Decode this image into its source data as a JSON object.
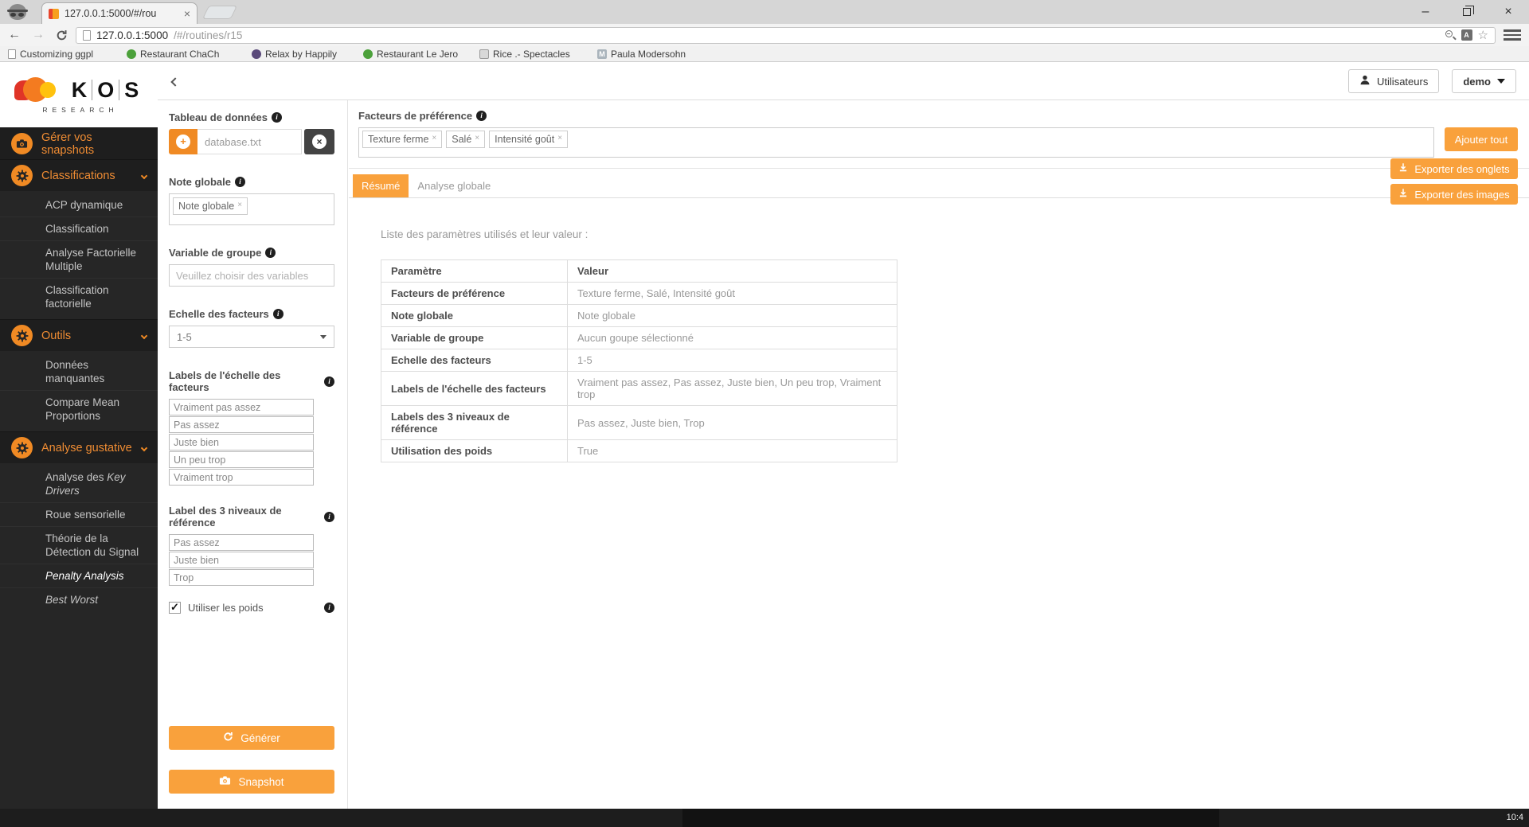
{
  "icons": {
    "plus": "+",
    "close": "×",
    "minimize": "–",
    "star": "☆",
    "arrow_left": "←",
    "arrow_right": "→",
    "translate_letter": "A",
    "paula_initial": "M"
  },
  "browser": {
    "tab": {
      "title": "127.0.0.1:5000/#/rou"
    },
    "url": {
      "host": "127.0.0.1:5000",
      "path": "/#/routines/r15"
    },
    "bookmarks": [
      {
        "label": "Customizing ggpl"
      },
      {
        "label": "Restaurant ChaCh"
      },
      {
        "label": "Relax by Happily"
      },
      {
        "label": "Restaurant Le Jero"
      },
      {
        "label": "Rice .- Spectacles"
      },
      {
        "label": "Paula Modersohn"
      }
    ]
  },
  "header": {
    "users": "Utilisateurs",
    "account": "demo"
  },
  "sidebar": {
    "logo_letters": [
      "K",
      "O",
      "S"
    ],
    "logo_sub": "RESEARCH",
    "items": [
      {
        "label": "Gérer vos snapshots"
      },
      {
        "label": "Classifications"
      },
      {
        "label": "Outils"
      },
      {
        "label": "Analyse gustative"
      }
    ],
    "classifications_children": [
      "ACP dynamique",
      "Classification",
      "Analyse Factorielle Multiple",
      "Classification factorielle"
    ],
    "outils_children": [
      "Données manquantes",
      "Compare Mean Proportions"
    ],
    "gustative_children": [
      {
        "prefix": "Analyse des ",
        "italic": "Key Drivers"
      },
      {
        "label": "Roue sensorielle"
      },
      {
        "label": "Théorie de la Détection du Signal"
      },
      {
        "label": "Penalty Analysis"
      },
      {
        "label": "Best Worst"
      }
    ]
  },
  "form": {
    "dataset_label": "Tableau de données",
    "dataset_value": "database.txt",
    "note_label": "Note globale",
    "note_tag": "Note globale",
    "group_label": "Variable de groupe",
    "group_placeholder": "Veuillez choisir des variables",
    "scale_label": "Echelle des facteurs",
    "scale_value": "1-5",
    "scale_labels_label": "Labels de l'échelle des facteurs",
    "scale_labels": [
      "Vraiment pas assez",
      "Pas assez",
      "Juste bien",
      "Un peu trop",
      "Vraiment trop"
    ],
    "ref_labels_label": "Label des 3 niveaux de référence",
    "ref_labels": [
      "Pas assez",
      "Juste bien",
      "Trop"
    ],
    "weights_label": "Utiliser les poids",
    "generate_label": "Générer",
    "snapshot_label": "Snapshot"
  },
  "main": {
    "factors_label": "Facteurs de préférence",
    "factor_tags": [
      "Texture ferme",
      "Salé",
      "Intensité goût"
    ],
    "add_all": "Ajouter tout",
    "tabs": [
      "Résumé",
      "Analyse globale"
    ],
    "export_tabs": "Exporter des onglets",
    "export_images": "Exporter des images",
    "table_intro": "Liste des paramètres utilisés et leur valeur :",
    "table": {
      "headers": [
        "Paramètre",
        "Valeur"
      ],
      "rows": [
        [
          "Facteurs de préférence",
          "Texture ferme, Salé, Intensité goût"
        ],
        [
          "Note globale",
          "Note globale"
        ],
        [
          "Variable de groupe",
          "Aucun goupe sélectionné"
        ],
        [
          "Echelle des facteurs",
          "1-5"
        ],
        [
          "Labels de l'échelle des facteurs",
          "Vraiment pas assez, Pas assez, Juste bien, Un peu trop, Vraiment trop"
        ],
        [
          "Labels des 3 niveaux de référence",
          "Pas assez, Juste bien, Trop"
        ],
        [
          "Utilisation des poids",
          "True"
        ]
      ]
    }
  },
  "footer": {
    "clock": "10:4"
  }
}
